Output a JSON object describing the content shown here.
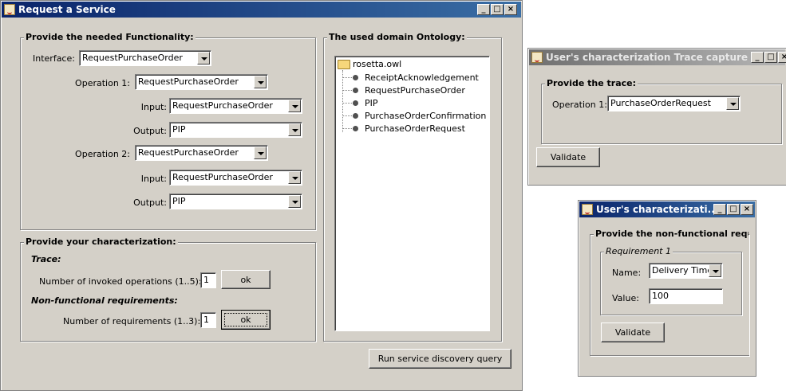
{
  "main_window": {
    "title": "Request a Service",
    "functionality": {
      "legend": "Provide the needed Functionality:",
      "interface_label": "Interface:",
      "interface_value": "RequestPurchaseOrder",
      "op1_label": "Operation 1:",
      "op1_value": "RequestPurchaseOrder",
      "op1_input_label": "Input:",
      "op1_input_value": "RequestPurchaseOrder",
      "op1_output_label": "Output:",
      "op1_output_value": "PIP",
      "op2_label": "Operation 2:",
      "op2_value": "RequestPurchaseOrder",
      "op2_input_label": "Input:",
      "op2_input_value": "RequestPurchaseOrder",
      "op2_output_label": "Output:",
      "op2_output_value": "PIP"
    },
    "characterization": {
      "legend": "Provide your characterization:",
      "trace_heading": "Trace:",
      "invoked_label": "Number of invoked operations (1..5):",
      "invoked_value": "1",
      "ok_label": "ok",
      "nf_heading": "Non-functional requirements:",
      "req_label": "Number of requirements (1..3):",
      "req_value": "1",
      "ok2_label": "ok"
    },
    "ontology": {
      "legend": "The used domain Ontology:",
      "root": "rosetta.owl",
      "items": [
        "ReceiptAcknowledgement",
        "RequestPurchaseOrder",
        "PIP",
        "PurchaseOrderConfirmation",
        "PurchaseOrderRequest"
      ]
    },
    "run_button": "Run service discovery query"
  },
  "trace_window": {
    "title": "User's characterization Trace capture",
    "legend": "Provide the trace:",
    "op1_label": "Operation 1:",
    "op1_value": "PurchaseOrderRequest",
    "validate_label": "Validate"
  },
  "nf_window": {
    "title": "User's characterizati...",
    "legend": "Provide the non-functional requ",
    "req_legend": "Requirement 1",
    "name_label": "Name:",
    "name_value": "Delivery Time",
    "value_label": "Value:",
    "value_value": "100",
    "validate_label": "Validate"
  },
  "window_buttons": {
    "minimize": "_",
    "maximize": "□",
    "close": "×"
  }
}
